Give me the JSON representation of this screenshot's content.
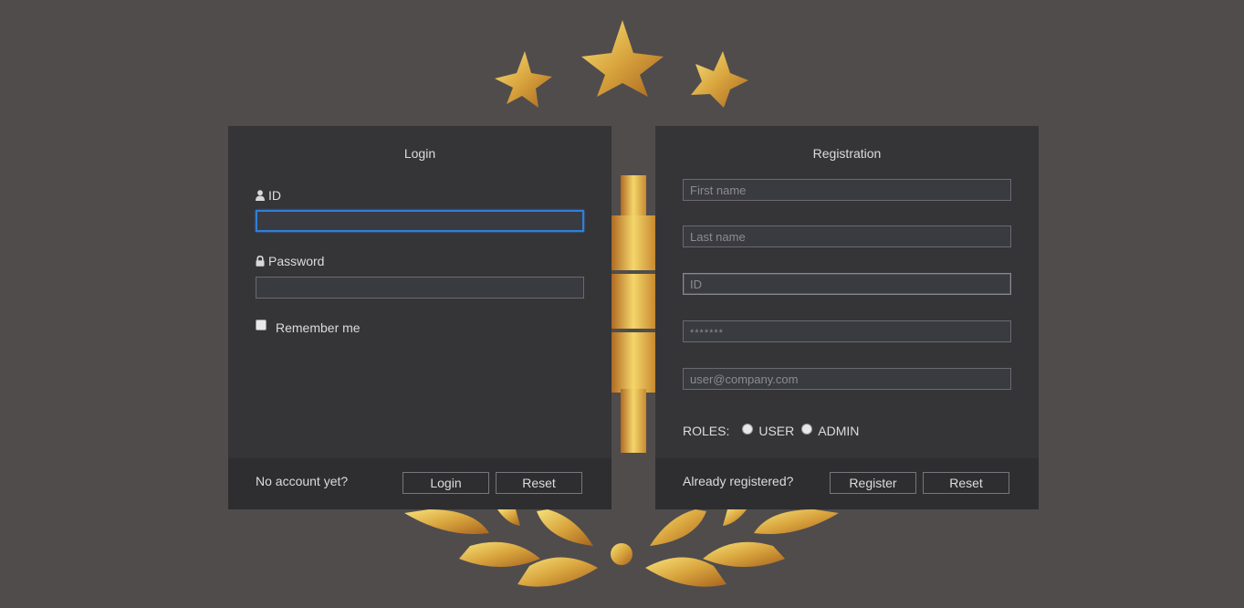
{
  "colors": {
    "background": "#504c4c",
    "panel": "#353437",
    "footer": "#2e2e30",
    "gold": "#e6c050",
    "focus": "#2f7fd8"
  },
  "emblem": {
    "description_icons": [
      "star-icon",
      "bitcoin-symbol-icon",
      "laurel-wreath-icon"
    ]
  },
  "login": {
    "title": "Login",
    "id_label": "ID",
    "id_value": "",
    "password_label": "Password",
    "password_value": "",
    "remember_label": "Remember me",
    "remember_checked": false,
    "footer_text": "No account yet?",
    "login_button": "Login",
    "reset_button": "Reset"
  },
  "registration": {
    "title": "Registration",
    "first_name_placeholder": "First name",
    "last_name_placeholder": "Last name",
    "id_placeholder": "ID",
    "password_placeholder": "*******",
    "email_placeholder": "user@company.com",
    "roles_label": "ROLES:",
    "role_user": "USER",
    "role_admin": "ADMIN",
    "footer_text": "Already registered?",
    "register_button": "Register",
    "reset_button": "Reset"
  }
}
